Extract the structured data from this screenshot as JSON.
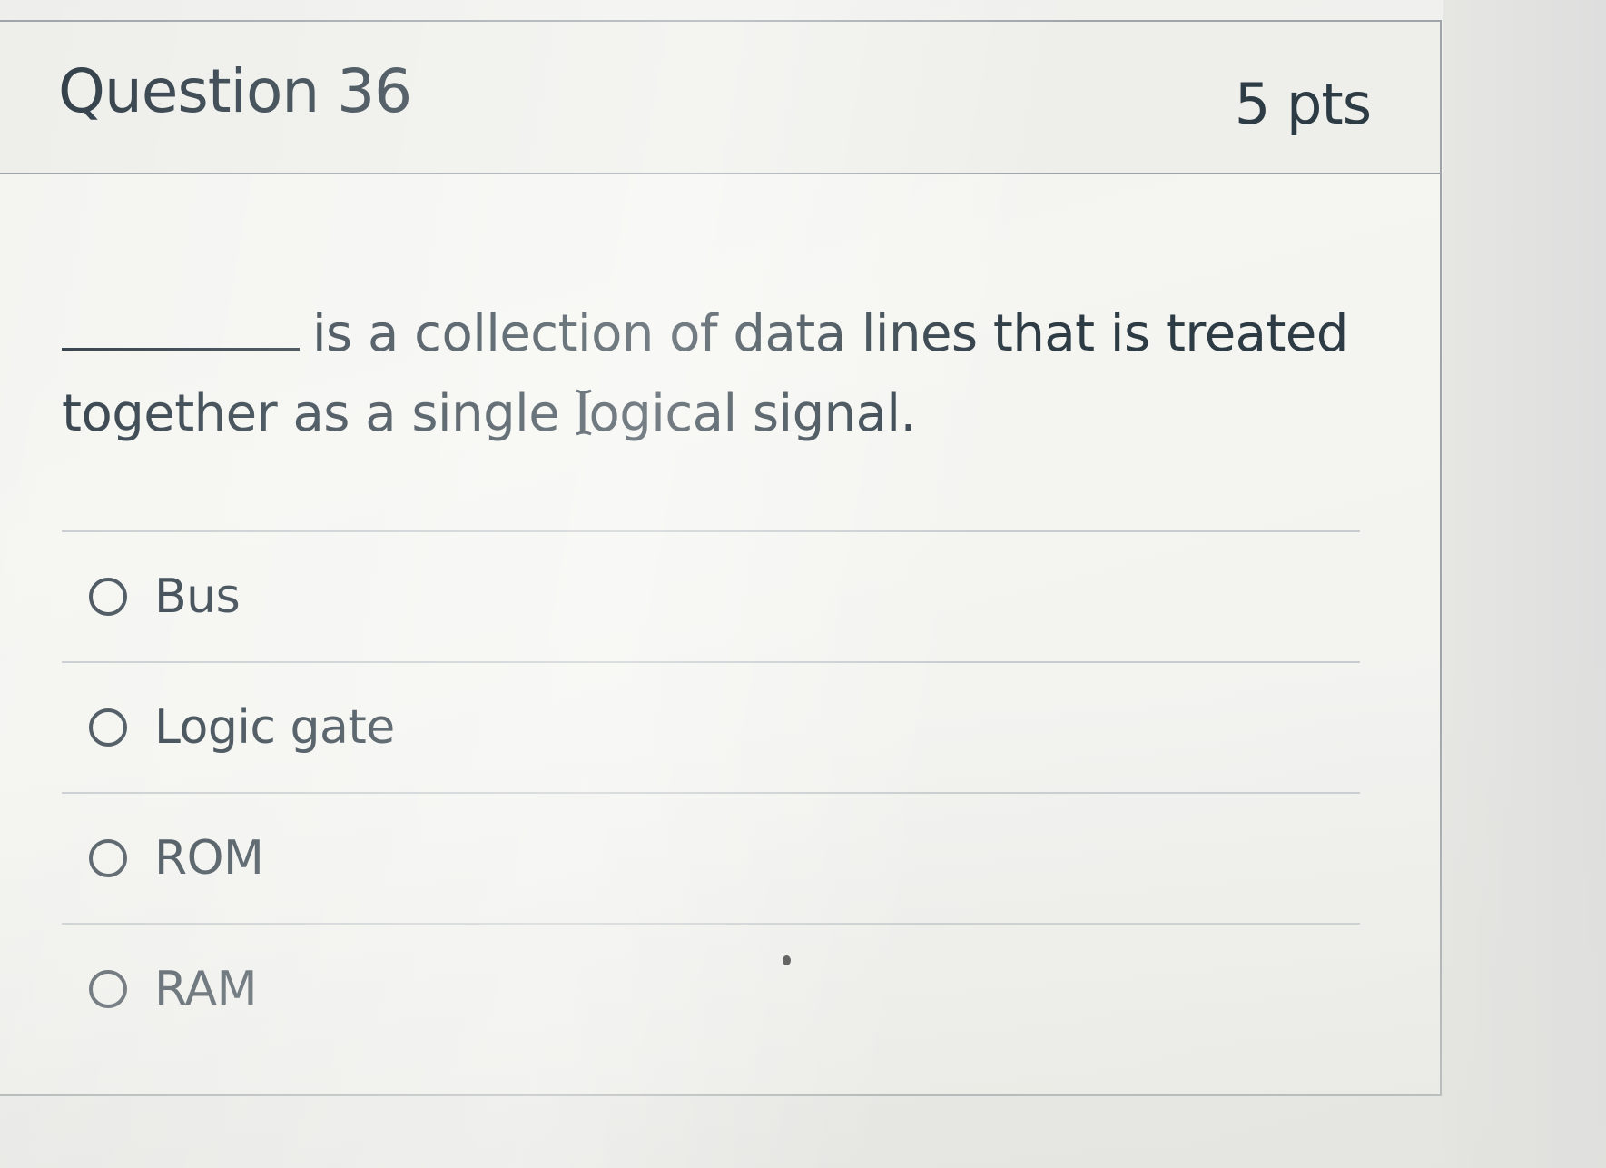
{
  "question": {
    "title": "Question 36",
    "points": "5 pts",
    "prompt_line1": "is a collection of data lines that is treated",
    "prompt_line2": "together as a single logical signal."
  },
  "answers": [
    {
      "label": "Bus",
      "selected": false
    },
    {
      "label": "Logic gate",
      "selected": false
    },
    {
      "label": "ROM",
      "selected": false
    },
    {
      "label": "RAM",
      "selected": false
    }
  ],
  "colors": {
    "text": "#2d3b45",
    "border": "#9ea4a8",
    "divider": "#c8ccce",
    "header_bg": "#ececea"
  },
  "icons": [
    "radio-unchecked-icon",
    "text-cursor-icon"
  ]
}
